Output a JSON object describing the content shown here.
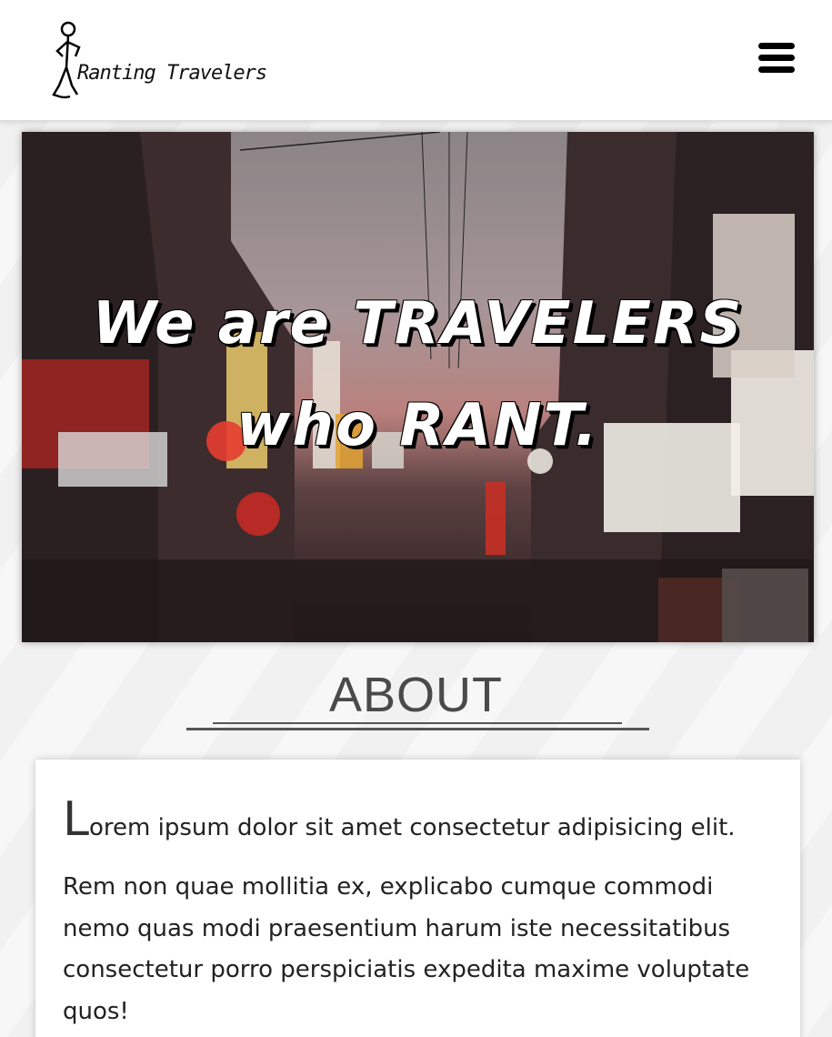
{
  "header": {
    "brand": "Ranting Travelers"
  },
  "hero": {
    "line1": "We are TRAVELERS",
    "line2": "who RANT."
  },
  "about": {
    "heading": "ABOUT",
    "drop_cap": "L",
    "lead_rest": "orem ipsum dolor sit amet consectetur adipisicing elit.",
    "body": "Rem non quae mollitia ex, explicabo cumque commodi nemo quas modi praesentium harum iste necessitatibus consectetur porro perspiciatis expedita maxime voluptate quos!"
  }
}
